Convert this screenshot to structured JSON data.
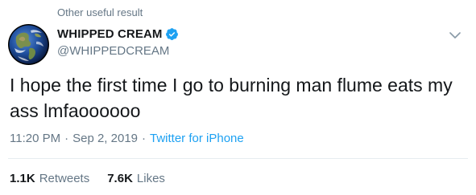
{
  "context": {
    "label": "Other useful result"
  },
  "author": {
    "name": "WHIPPED CREAM",
    "handle": "@WHIPPEDCREAM",
    "verified": true,
    "verified_color": "#1da1f2"
  },
  "tweet": {
    "text": "I hope the first time I go to burning man flume eats my ass lmfaoooooo"
  },
  "meta": {
    "time": "11:20 PM",
    "separator": "·",
    "date": "Sep 2, 2019",
    "source": "Twitter for iPhone"
  },
  "stats": {
    "retweets_count": "1.1K",
    "retweets_label": "Retweets",
    "likes_count": "7.6K",
    "likes_label": "Likes"
  },
  "icons": {
    "verified": "verified-badge-icon",
    "menu": "chevron-down-icon",
    "avatar": "earth-globe-avatar"
  },
  "colors": {
    "primary_text": "#14171a",
    "secondary_text": "#657786",
    "link": "#1da1f2",
    "divider": "#e6ecf0"
  }
}
